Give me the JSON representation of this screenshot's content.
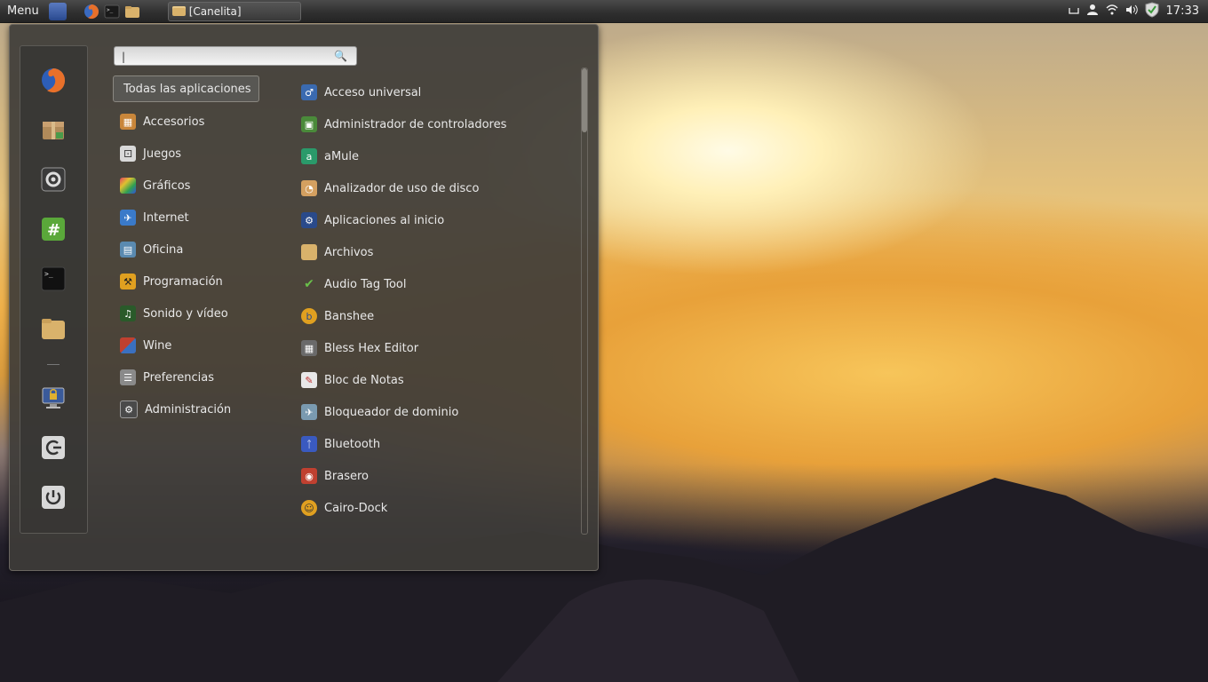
{
  "panel": {
    "menu_label": "Menu",
    "task_label": "[Canelita]",
    "clock": "17:33",
    "launchers": [
      "workspace-icon",
      "firefox-icon",
      "terminal-icon",
      "folder-icon"
    ]
  },
  "menu": {
    "search_placeholder": "",
    "search_value": "",
    "categories": [
      {
        "label": "Todas las aplicaciones",
        "icon": "all-apps"
      },
      {
        "label": "Accesorios",
        "icon": "accessories-icon",
        "color": "#c9863a"
      },
      {
        "label": "Juegos",
        "icon": "games-icon",
        "color": "#d9d9d9"
      },
      {
        "label": "Gráficos",
        "icon": "graphics-icon",
        "color": "#e04060"
      },
      {
        "label": "Internet",
        "icon": "internet-icon",
        "color": "#3a7ac9"
      },
      {
        "label": "Oficina",
        "icon": "office-icon",
        "color": "#5a8ab0"
      },
      {
        "label": "Programación",
        "icon": "programming-icon",
        "color": "#e0a020"
      },
      {
        "label": "Sonido y vídeo",
        "icon": "multimedia-icon",
        "color": "#3a8a3a"
      },
      {
        "label": "Wine",
        "icon": "wine-icon",
        "color": "#c04030"
      },
      {
        "label": "Preferencias",
        "icon": "preferences-icon",
        "color": "#8a8a8a"
      },
      {
        "label": "Administración",
        "icon": "administration-icon",
        "color": "#5a5a5a"
      }
    ],
    "apps": [
      {
        "label": "Acceso universal",
        "icon": "accessibility-icon",
        "color": "#3a6ab0"
      },
      {
        "label": "Administrador de controladores",
        "icon": "driver-manager-icon",
        "color": "#4a8a3a"
      },
      {
        "label": "aMule",
        "icon": "amule-icon",
        "color": "#2a9a6a"
      },
      {
        "label": "Analizador de uso de disco",
        "icon": "disk-usage-icon",
        "color": "#d4a060"
      },
      {
        "label": "Aplicaciones al inicio",
        "icon": "startup-apps-icon",
        "color": "#2a4a8a"
      },
      {
        "label": "Archivos",
        "icon": "files-icon",
        "color": "#d9b26b"
      },
      {
        "label": "Audio Tag Tool",
        "icon": "audio-tag-icon",
        "color": "#3a7a3a"
      },
      {
        "label": "Banshee",
        "icon": "banshee-icon",
        "color": "#e0a020"
      },
      {
        "label": "Bless Hex Editor",
        "icon": "hex-editor-icon",
        "color": "#6a6a6a"
      },
      {
        "label": "Bloc de Notas",
        "icon": "notepad-icon",
        "color": "#e8e8e8"
      },
      {
        "label": "Bloqueador de dominio",
        "icon": "domain-blocker-icon",
        "color": "#7a9ab0"
      },
      {
        "label": "Bluetooth",
        "icon": "bluetooth-icon",
        "color": "#3a5ac0"
      },
      {
        "label": "Brasero",
        "icon": "brasero-icon",
        "color": "#c04030"
      },
      {
        "label": "Cairo-Dock",
        "icon": "cairo-dock-icon",
        "color": "#e0a020"
      }
    ],
    "favorites": [
      {
        "name": "firefox",
        "color": "#e0702a"
      },
      {
        "name": "package-installer",
        "color": "#b08a5a"
      },
      {
        "name": "system-settings",
        "color": "#4a4a4a"
      },
      {
        "name": "hexchat",
        "color": "#5aa03a"
      },
      {
        "name": "terminal",
        "color": "#1a1a1a"
      },
      {
        "name": "home-folder",
        "color": "#d9b26b"
      },
      {
        "name": "lock-screen",
        "color": "#3a5a9a"
      },
      {
        "name": "logout",
        "color": "#d8d8d8"
      },
      {
        "name": "shutdown",
        "color": "#d8d8d8"
      }
    ]
  }
}
